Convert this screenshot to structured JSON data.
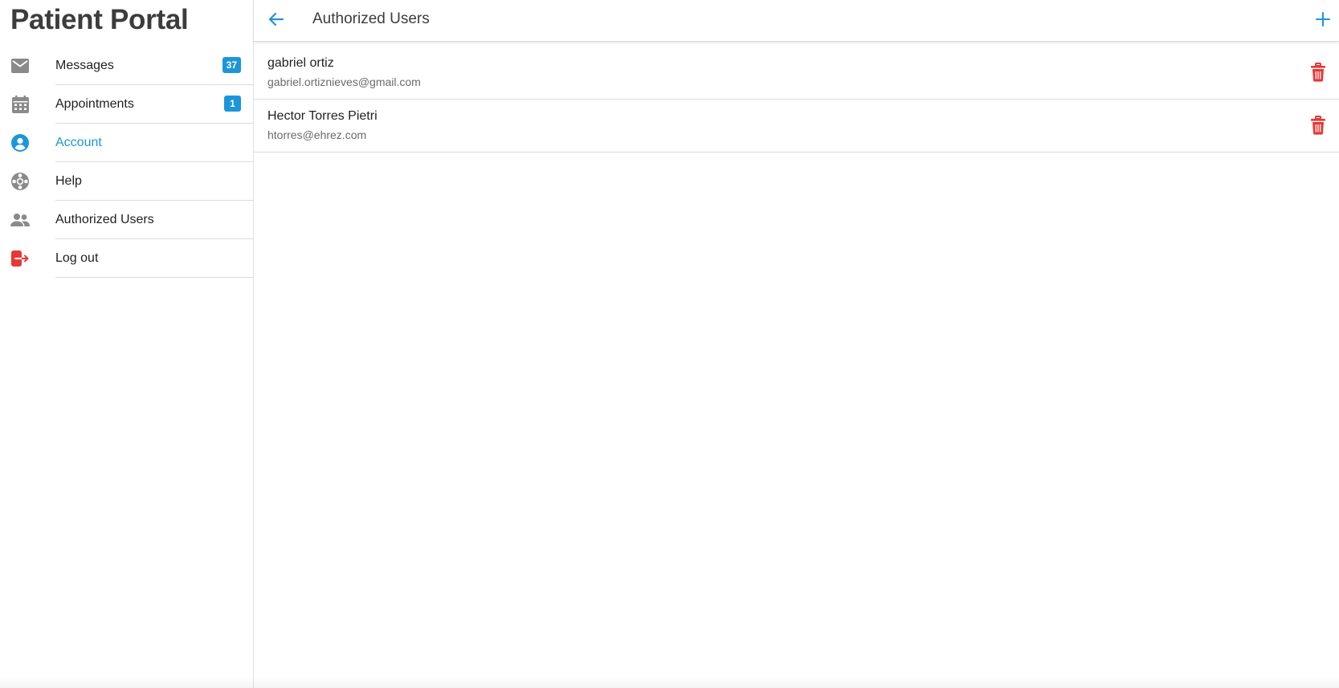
{
  "app": {
    "title": "Patient Portal"
  },
  "sidebar": {
    "items": [
      {
        "label": "Messages",
        "icon": "mail-icon",
        "badge": "37"
      },
      {
        "label": "Appointments",
        "icon": "calendar-icon",
        "badge": "1"
      },
      {
        "label": "Account",
        "icon": "account-circle-icon",
        "active": true
      },
      {
        "label": "Help",
        "icon": "lifebuoy-icon"
      },
      {
        "label": "Authorized Users",
        "icon": "people-icon"
      },
      {
        "label": "Log out",
        "icon": "logout-icon"
      }
    ]
  },
  "header": {
    "title": "Authorized Users",
    "back_icon": "arrow-left-icon",
    "add_icon": "plus-icon"
  },
  "users": [
    {
      "name": "gabriel ortiz",
      "email": "gabriel.ortiznieves@gmail.com"
    },
    {
      "name": "Hector Torres Pietri",
      "email": "htorres@ehrez.com"
    }
  ],
  "colors": {
    "accent": "#1d96d8",
    "danger": "#e53935",
    "icon_gray": "#8a8a8a",
    "title": "#3c3c3c"
  }
}
